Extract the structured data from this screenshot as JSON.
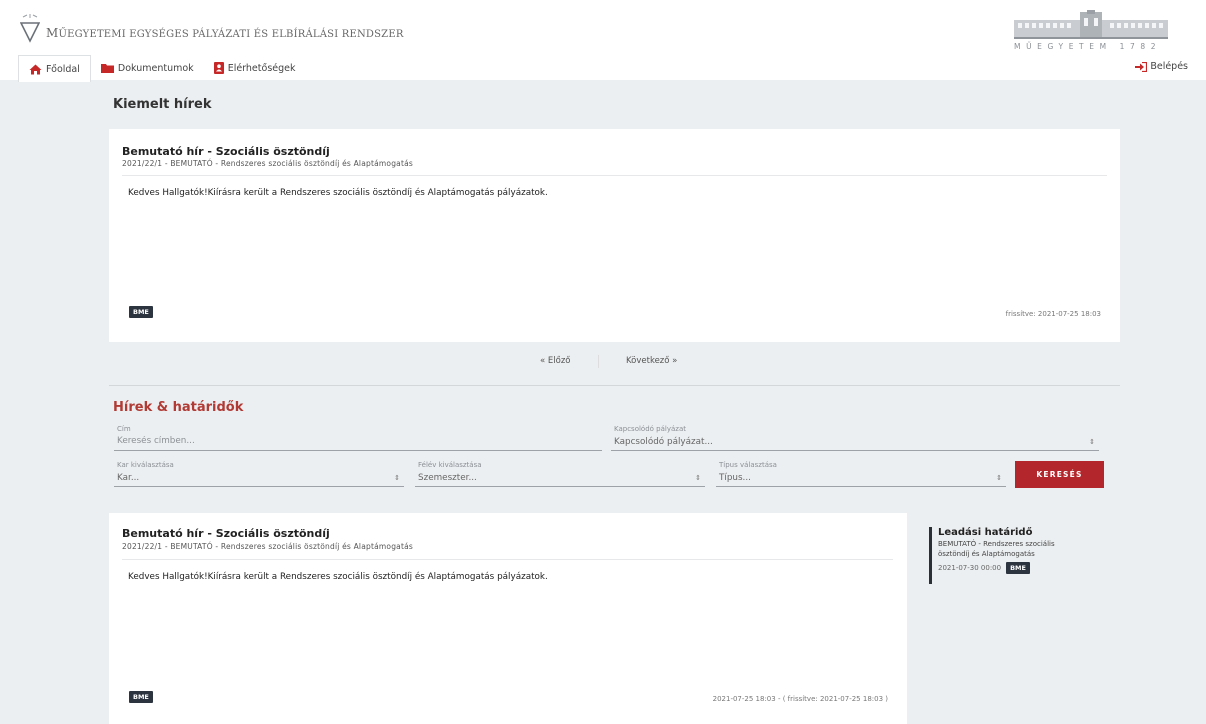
{
  "header": {
    "system_title_first": "M",
    "system_title_rest": "ŰEGYETEMI EGYSÉGES PÁLYÁZATI ÉS ELBÍRÁLÁSI RENDSZER",
    "bme_tagline": "MŰEGYETEM 1782"
  },
  "nav": {
    "items": [
      {
        "label": "Főoldal",
        "icon": "home-icon"
      },
      {
        "label": "Dokumentumok",
        "icon": "folder-icon"
      },
      {
        "label": "Elérhetőségek",
        "icon": "contact-icon"
      }
    ],
    "login": "Belépés"
  },
  "colors": {
    "accent_red": "#b3262b",
    "nav_icon_red": "#c62828",
    "badge_dark": "#2c3440"
  },
  "featured": {
    "section_title": "Kiemelt hírek",
    "title": "Bemutató hír - Szociális ösztöndíj",
    "subtitle": "2021/22/1 - BEMUTATÓ - Rendszeres szociális ösztöndíj és Alaptámogatás",
    "body": "Kedves Hallgatók!Kiírásra került a Rendszeres szociális ösztöndíj és Alaptámogatás pályázatok.",
    "badge": "BME",
    "updated": "frissítve: 2021-07-25 18:03"
  },
  "pager": {
    "prev": "« Előző",
    "next": "Következő »"
  },
  "filters": {
    "section_title": "Hírek & határidők",
    "title_label": "Cím",
    "title_placeholder": "Keresés címben...",
    "related_label": "Kapcsolódó pályázat",
    "related_value": "Kapcsolódó pályázat...",
    "faculty_label": "Kar kiválasztása",
    "faculty_value": "Kar...",
    "semester_label": "Félév kiválasztása",
    "semester_value": "Szemeszter...",
    "type_label": "Típus választása",
    "type_value": "Típus...",
    "search_button": "KERESÉS"
  },
  "news": {
    "title": "Bemutató hír - Szociális ösztöndíj",
    "subtitle": "2021/22/1 - BEMUTATÓ - Rendszeres szociális ösztöndíj és Alaptámogatás",
    "body": "Kedves Hallgatók!Kiírásra került a Rendszeres szociális ösztöndíj és Alaptámogatás pályázatok.",
    "badge": "BME",
    "date": "2021-07-25 18:03 - ( frissítve: 2021-07-25 18:03 )"
  },
  "deadline": {
    "title": "Leadási határidő",
    "subtitle": "BEMUTATÓ - Rendszeres szociális ösztöndíj és Alaptámogatás",
    "date": "2021-07-30 00:00",
    "badge": "BME"
  }
}
